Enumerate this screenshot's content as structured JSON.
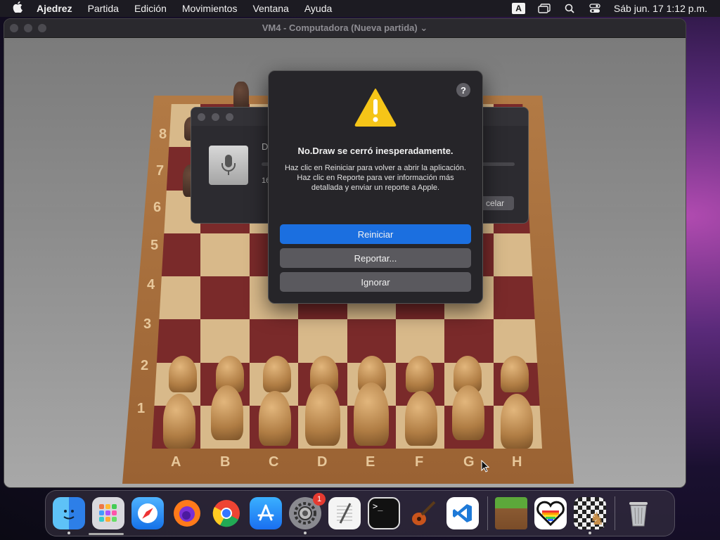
{
  "menubar": {
    "app_name": "Ajedrez",
    "items": [
      "Partida",
      "Edición",
      "Movimientos",
      "Ventana",
      "Ayuda"
    ],
    "input_badge": "A",
    "clock": "Sáb jun. 17  1:12 p.m."
  },
  "window": {
    "title": "VM4 - Computadora   (Nueva partida)"
  },
  "board": {
    "ranks": [
      "8",
      "7",
      "6",
      "5",
      "4",
      "3",
      "2",
      "1"
    ],
    "files": [
      "A",
      "B",
      "C",
      "D",
      "E",
      "F",
      "G",
      "H"
    ]
  },
  "dictation": {
    "text_fragment": "D",
    "number_fragment": "16",
    "cancel_label": "celar"
  },
  "alert": {
    "help_label": "?",
    "title": "No.Draw se cerró inesperadamente.",
    "message": "Haz clic en Reiniciar para volver a abrir la aplicación. Haz clic en Reporte para ver información más detallada y enviar un reporte a Apple.",
    "buttons": {
      "restart": "Reiniciar",
      "report": "Reportar...",
      "ignore": "Ignorar"
    }
  },
  "dock": {
    "items": [
      {
        "name": "finder",
        "icon": "finder-icon"
      },
      {
        "name": "launchpad",
        "icon": "launchpad-icon"
      },
      {
        "name": "safari",
        "icon": "safari-icon"
      },
      {
        "name": "firefox",
        "icon": "firefox-icon"
      },
      {
        "name": "chrome",
        "icon": "chrome-icon"
      },
      {
        "name": "app-store",
        "icon": "app-store-icon"
      },
      {
        "name": "system-settings",
        "icon": "gear-icon",
        "badge": "1"
      },
      {
        "name": "textedit",
        "icon": "notepad-icon"
      },
      {
        "name": "terminal",
        "icon": "terminal-icon"
      },
      {
        "name": "garageband",
        "icon": "guitar-icon"
      },
      {
        "name": "vscode",
        "icon": "vscode-icon"
      },
      {
        "name": "minecraft",
        "icon": "grass-block-icon"
      },
      {
        "name": "pixel-heart",
        "icon": "pixel-heart-icon"
      },
      {
        "name": "chess",
        "icon": "chess-icon"
      },
      {
        "name": "trash",
        "icon": "trash-icon"
      }
    ]
  },
  "colors": {
    "accent": "#1b6fe0",
    "warning": "#f5c518",
    "notification": "#e53a30"
  }
}
